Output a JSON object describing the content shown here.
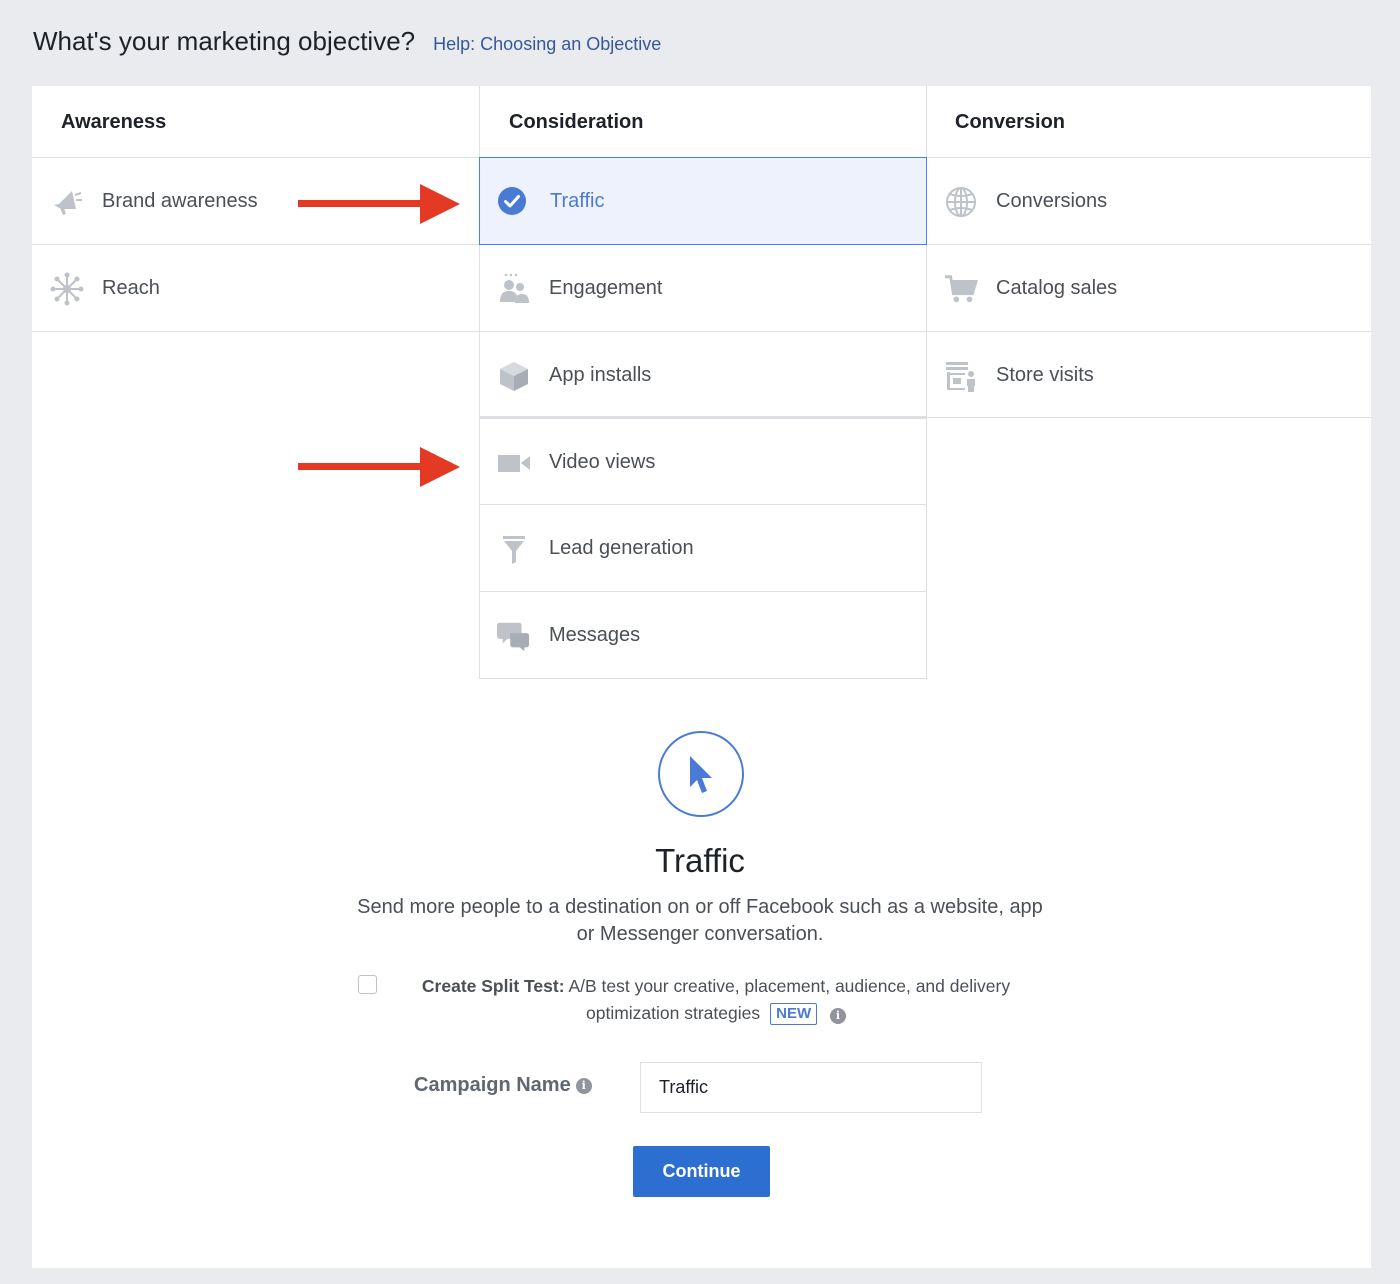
{
  "header": {
    "title": "What's your marketing objective?",
    "help_link": "Help: Choosing an Objective"
  },
  "columns": [
    {
      "heading": "Awareness",
      "items": [
        {
          "label": "Brand awareness",
          "icon": "megaphone-icon"
        },
        {
          "label": "Reach",
          "icon": "reach-icon"
        }
      ]
    },
    {
      "heading": "Consideration",
      "items": [
        {
          "label": "Traffic",
          "icon": "check-circle-icon",
          "selected": true
        },
        {
          "label": "Engagement",
          "icon": "people-icon"
        },
        {
          "label": "App installs",
          "icon": "box-icon"
        },
        {
          "label": "Video views",
          "icon": "video-camera-icon"
        },
        {
          "label": "Lead generation",
          "icon": "funnel-icon"
        },
        {
          "label": "Messages",
          "icon": "chat-bubbles-icon"
        }
      ]
    },
    {
      "heading": "Conversion",
      "items": [
        {
          "label": "Conversions",
          "icon": "globe-icon"
        },
        {
          "label": "Catalog sales",
          "icon": "cart-icon"
        },
        {
          "label": "Store visits",
          "icon": "store-icon"
        }
      ]
    }
  ],
  "detail": {
    "icon": "cursor-icon",
    "title": "Traffic",
    "description": "Send more people to a destination on or off Facebook such as a website, app or Messenger conversation."
  },
  "split_test": {
    "label": "Create Split Test:",
    "text": "A/B test your creative, placement, audience, and delivery optimization strategies",
    "badge": "NEW",
    "checked": false
  },
  "campaign": {
    "label": "Campaign Name",
    "value": "Traffic"
  },
  "continue_label": "Continue",
  "colors": {
    "accent": "#4a7bd4",
    "button": "#2d6fd1",
    "arrow": "#e43a25",
    "icon_gray": "#bec3c9"
  }
}
